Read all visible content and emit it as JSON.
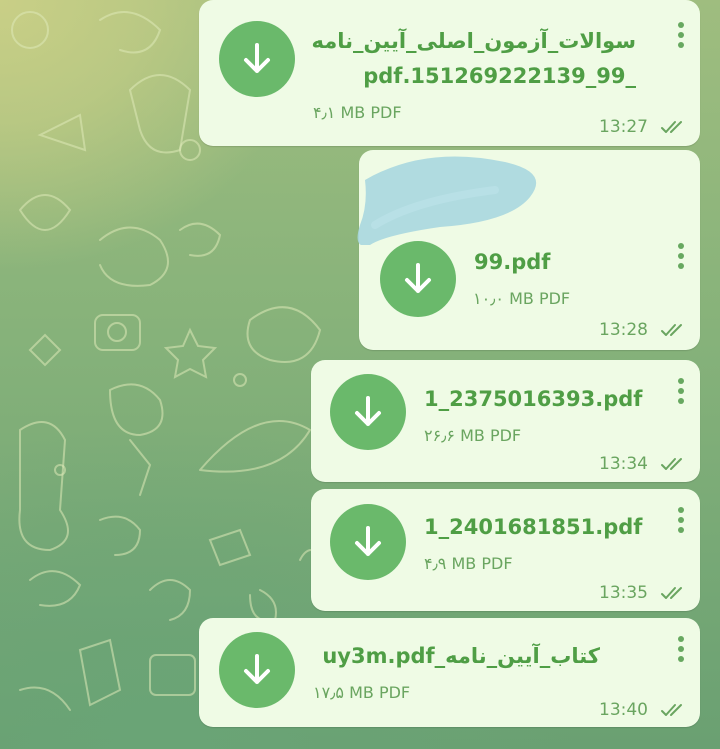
{
  "colors": {
    "bubble_background": "#effbe5",
    "accent": "#4f9e45",
    "download_button": "#6ab96b"
  },
  "messages": [
    {
      "file_name_line1": "سوالات_آزمون_اصلی_آیین_نامه",
      "file_name_line2": "_99_151269222139.pdf",
      "size": "۴٫۱ MB PDF",
      "time": "13:27",
      "icon": "download-icon"
    },
    {
      "file_name_line1": "99.pdf",
      "size": "۱۰٫۰ MB PDF",
      "time": "13:28",
      "icon": "download-icon"
    },
    {
      "file_name_line1": "1_2375016393.pdf",
      "size": "۲۶٫۶ MB PDF",
      "time": "13:34",
      "icon": "download-icon"
    },
    {
      "file_name_line1": "1_2401681851.pdf",
      "size": "۴٫۹ MB PDF",
      "time": "13:35",
      "icon": "download-icon"
    },
    {
      "file_name_line1": "کتاب_آیین_نامه_uy3m.pdf",
      "size": "۱۷٫۵ MB PDF",
      "time": "13:40",
      "icon": "download-icon"
    }
  ]
}
